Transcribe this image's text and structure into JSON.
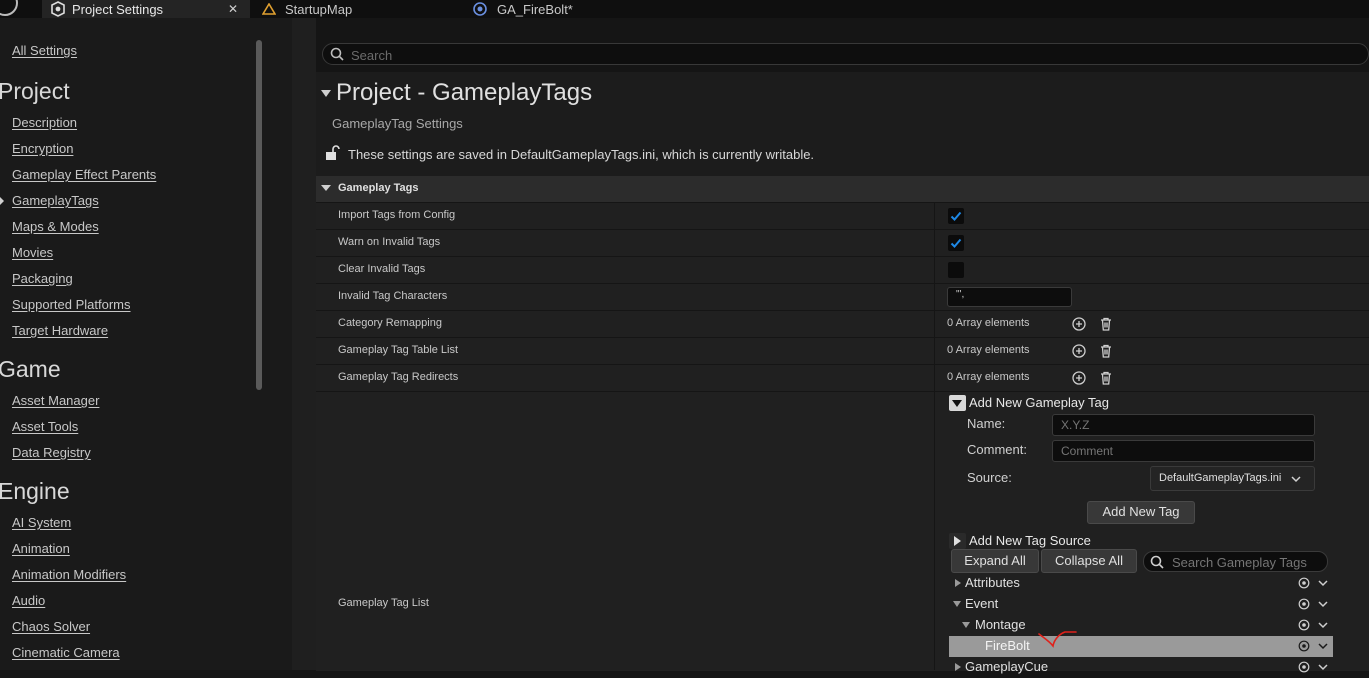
{
  "tabs": [
    {
      "label": "Project Settings",
      "active": true
    },
    {
      "label": "StartupMap",
      "active": false
    },
    {
      "label": "GA_FireBolt*",
      "active": false
    }
  ],
  "sidebar": {
    "all_settings": "All Settings",
    "sections": [
      {
        "title": "Project",
        "items": [
          "Description",
          "Encryption",
          "Gameplay Effect Parents",
          "GameplayTags",
          "Maps & Modes",
          "Movies",
          "Packaging",
          "Supported Platforms",
          "Target Hardware"
        ]
      },
      {
        "title": "Game",
        "items": [
          "Asset Manager",
          "Asset Tools",
          "Data Registry"
        ]
      },
      {
        "title": "Engine",
        "items": [
          "AI System",
          "Animation",
          "Animation Modifiers",
          "Audio",
          "Chaos Solver",
          "Cinematic Camera"
        ]
      }
    ],
    "active_item": "GameplayTags"
  },
  "search": {
    "placeholder": "Search"
  },
  "page": {
    "title": "Project - GameplayTags",
    "subtitle": "GameplayTag Settings",
    "notice": "These settings are saved in DefaultGameplayTags.ini, which is currently writable."
  },
  "section": {
    "title": "Gameplay Tags",
    "rows": [
      {
        "name": "Import Tags from Config",
        "checked": true
      },
      {
        "name": "Warn on Invalid Tags",
        "checked": true
      },
      {
        "name": "Clear Invalid Tags",
        "checked": false
      },
      {
        "name": "Invalid Tag Characters",
        "value": "\"',"
      },
      {
        "name": "Category Remapping",
        "count": "0 Array elements"
      },
      {
        "name": "Gameplay Tag Table List",
        "count": "0 Array elements"
      },
      {
        "name": "Gameplay Tag Redirects",
        "count": "0 Array elements"
      }
    ],
    "tag_list_label": "Gameplay Tag List"
  },
  "add_tag": {
    "header": "Add New Gameplay Tag",
    "name_label": "Name:",
    "name_placeholder": "X.Y.Z",
    "comment_label": "Comment:",
    "comment_placeholder": "Comment",
    "source_label": "Source:",
    "source_value": "DefaultGameplayTags.ini",
    "button": "Add New Tag"
  },
  "add_source": {
    "header": "Add New Tag Source"
  },
  "tree_toolbar": {
    "expand_all": "Expand All",
    "collapse_all": "Collapse All",
    "search_placeholder": "Search Gameplay Tags"
  },
  "tree": [
    {
      "label": "Attributes",
      "depth": 0,
      "expanded": false
    },
    {
      "label": "Event",
      "depth": 0,
      "expanded": true
    },
    {
      "label": "Montage",
      "depth": 1,
      "expanded": true
    },
    {
      "label": "FireBolt",
      "depth": 2,
      "selected": true
    },
    {
      "label": "GameplayCue",
      "depth": 0,
      "expanded": false
    }
  ],
  "colors": {
    "accent_check": "#1e88e5",
    "selected_row": "#9a9a9a",
    "annotation": "#e0201a"
  }
}
